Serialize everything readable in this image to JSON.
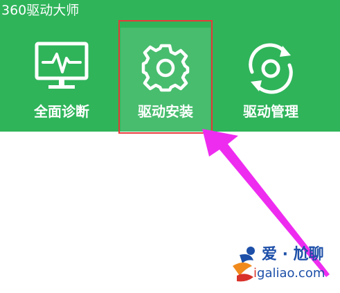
{
  "window": {
    "title": "360驱动大师",
    "header_color": "#2fb45a"
  },
  "nav": {
    "tabs": [
      {
        "label": "全面诊断",
        "icon": "monitor-pulse-icon",
        "active": false
      },
      {
        "label": "驱动安装",
        "icon": "gear-icon",
        "active": true
      },
      {
        "label": "驱动管理",
        "icon": "refresh-cycle-icon",
        "active": false
      }
    ]
  },
  "annotation": {
    "highlight_color": "#e83a3a",
    "arrow_color": "#ee2cf0"
  },
  "watermark": {
    "title": "爱 · 尬聊",
    "url_prefix": "i",
    "url_rest": "galiao.com",
    "colors": {
      "blue": "#1d4fa8",
      "red": "#d8322a"
    }
  }
}
